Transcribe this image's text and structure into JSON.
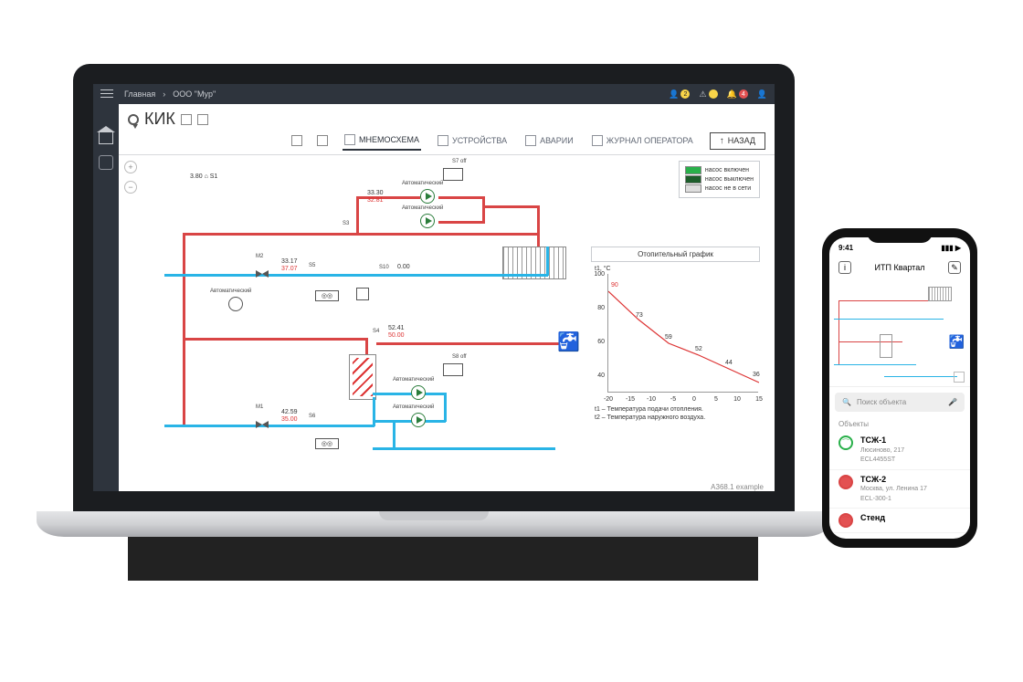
{
  "breadcrumbs": {
    "home": "Главная",
    "org": "ООО \"Мур\""
  },
  "page_title": "КИК",
  "topbar_badges": {
    "users": "2",
    "warn": "",
    "bell": "4"
  },
  "tabs": {
    "mnemo": "МНЕМОСХЕМА",
    "devices": "УСТРОЙСТВА",
    "alarms": "АВАРИИ",
    "log": "ЖУРНАЛ ОПЕРАТОРА"
  },
  "back": "НАЗАД",
  "legend": {
    "on": "насос включен",
    "off": "насос выключен",
    "na": "насос не в сети"
  },
  "diagram": {
    "s1": "S1",
    "s1_v": "3.80",
    "s3": "S3",
    "s3_v1": "33.30",
    "s3_v2": "32.81",
    "auto": "Автоматический",
    "s7": "S7",
    "s7_off": "off",
    "s5": "S5",
    "s5_v1": "33.17",
    "s5_v2": "37.07",
    "m2": "M2",
    "s10": "S10",
    "s10_v": "0.00",
    "s4": "S4",
    "s4_v1": "52.41",
    "s4_v2": "50.00",
    "s8": "S8",
    "s8_off": "off",
    "m1": "M1",
    "s6": "S6",
    "s6_v1": "42.59",
    "s6_v2": "35.00"
  },
  "chart_title": "Отопительный график",
  "chart_axis_y": "t1, °C",
  "chart_caption1": "t1 – Температура подачи отопления.",
  "chart_caption2": "t2 – Температура наружного воздуха.",
  "chart_data": {
    "type": "line",
    "x": [
      -20,
      -15,
      -10,
      -5,
      0,
      5,
      10,
      15
    ],
    "y": [
      90,
      73,
      59,
      52,
      44,
      36
    ],
    "x_ticks": [
      -20,
      -15,
      -10,
      -5,
      0,
      5,
      10,
      15
    ],
    "y_ticks": [
      40,
      60,
      80,
      100
    ],
    "data_labels": [
      90,
      73,
      59,
      52,
      44,
      36
    ],
    "xlabel": "t2",
    "ylabel": "t1, °C",
    "xlim": [
      -20,
      15
    ],
    "ylim": [
      30,
      100
    ]
  },
  "footer": "A368.1 example",
  "phone": {
    "time": "9:41",
    "title": "ИТП Квартал",
    "search": "Поиск объекта",
    "section": "Объекты",
    "items": [
      {
        "name": "ТСЖ-1",
        "addr": "Люсиново, 217",
        "dev": "ECL4455ST"
      },
      {
        "name": "ТСЖ-2",
        "addr": "Москва, ул. Ленина 17",
        "dev": "ECL-300-1"
      },
      {
        "name": "Стенд",
        "addr": "",
        "dev": ""
      }
    ]
  }
}
